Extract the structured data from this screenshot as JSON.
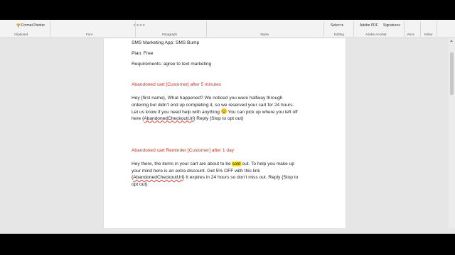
{
  "ribbon": {
    "format_painter": "Format Painter",
    "select_label": "Select",
    "adobe_pdf": "Adobe PDF",
    "signatures": "Signatures",
    "groups": {
      "clipboard": "Clipboard",
      "font": "Font",
      "paragraph": "Paragraph",
      "styles": "Styles",
      "editing": "Editing",
      "adobe_acrobat": "Adobe Acrobat",
      "voice": "Voice",
      "editor": "Editor"
    }
  },
  "document": {
    "app_line": "SMS Marketing App: SMS Bump",
    "plan_line": "Plan: Free",
    "requirements_line": "Requirements: agree to text marketing",
    "section1": {
      "heading": "Abandoned cart [Customer] after 5 minutes",
      "l1": "Hey {first name}, What happened? We noticed you were halfway through",
      "l2": "ordering but didn’t end up completing it, so we reserved your cart for 24 hours.",
      "l3a": "Let us know if you need help with anything",
      "l3b": " You can pick up where you left off",
      "l4a": "here {",
      "l4b": "AbandonedCheckoutUrl",
      "l4c": "} Reply {Stop to opt out}"
    },
    "section2": {
      "heading": "Abandoned cart Reminder [Customer] after 1 day",
      "l1a": "Hey there, the items in your cart are about to be ",
      "l1b": "sold",
      "l1c": " out. To help you make up",
      "l2": "your mind here is an extra discount. Get 5% OFF with this link",
      "l3a": "{",
      "l3b": "AbandonedCheckoutUrl",
      "l3c": "} It expires in 24 hours so don’t miss out. Reply {Stop to",
      "l4": "opt out}"
    }
  },
  "colors": {
    "heading_red": "#c0392b",
    "highlight": "#ffe600",
    "emoji_yellow": "#f5c518"
  },
  "icons": {
    "emoji": "smiling-face-icon"
  }
}
